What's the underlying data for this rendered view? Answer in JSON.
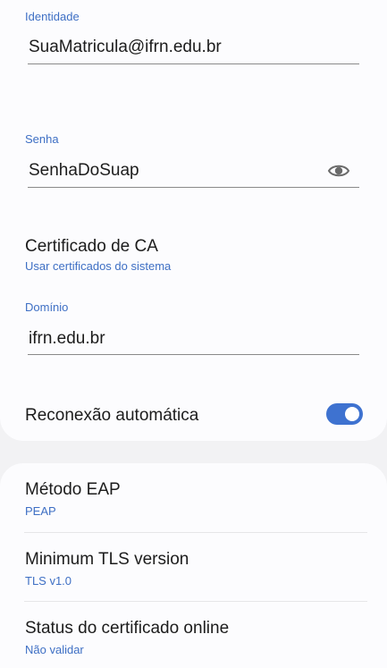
{
  "identity": {
    "label": "Identidade",
    "value": "SuaMatricula@ifrn.edu.br"
  },
  "password": {
    "label": "Senha",
    "value": "SenhaDoSuap",
    "toggle_icon": "eye-icon"
  },
  "ca_certificate": {
    "title": "Certificado de CA",
    "value": "Usar certificados do sistema"
  },
  "domain": {
    "label": "Domínio",
    "value": "ifrn.edu.br"
  },
  "auto_reconnect": {
    "title": "Reconexão automática",
    "enabled": true
  },
  "eap_method": {
    "title": "Método EAP",
    "value": "PEAP"
  },
  "min_tls": {
    "title": "Minimum TLS version",
    "value": "TLS v1.0"
  },
  "online_cert_status": {
    "title": "Status do certificado online",
    "value": "Não validar"
  },
  "colors": {
    "accent": "#3e6fc4",
    "toggle_on": "#3e72d0",
    "card_bg": "#fcfcfe",
    "page_bg": "#f2f2f4"
  }
}
